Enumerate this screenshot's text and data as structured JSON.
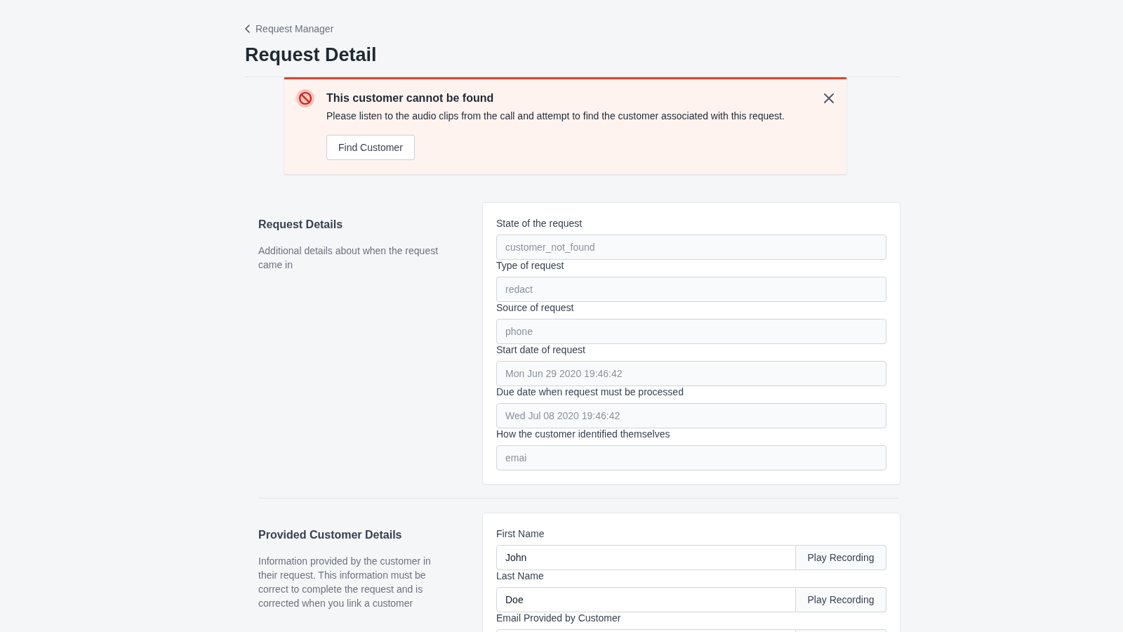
{
  "breadcrumb": {
    "label": "Request Manager"
  },
  "page_title": "Request Detail",
  "alert": {
    "kind": "error",
    "title": "This customer cannot be found",
    "message": "Please listen to the audio clips from the call and attempt to find the customer associated with this request.",
    "action": "Find Customer",
    "dismissible": true
  },
  "sections": [
    {
      "title": "Request Details",
      "description": "Additional details about when the request came in",
      "fields": [
        {
          "kind": "text",
          "label": "State of the request",
          "value": "customer_not_found",
          "disabled": true
        },
        {
          "kind": "text",
          "label": "Type of request",
          "value": "redact",
          "disabled": true
        },
        {
          "kind": "text",
          "label": "Source of request",
          "value": "phone",
          "disabled": true
        },
        {
          "kind": "text",
          "label": "Start date of request",
          "value": "Mon Jun 29 2020 19:46:42",
          "disabled": true
        },
        {
          "kind": "text",
          "label": "Due date when request must be processed",
          "value": "Wed Jul 08 2020 19:46:42",
          "disabled": true
        },
        {
          "kind": "text",
          "label": "How the customer identified themselves",
          "value": "emai",
          "disabled": true
        }
      ]
    },
    {
      "title": "Provided Customer Details",
      "description": "Information provided by the customer in their request. This information must be correct to complete the request and is corrected when you link a customer",
      "fields": [
        {
          "kind": "recording",
          "label": "First Name",
          "value": "John",
          "disabled": false,
          "action": "Play Recording"
        },
        {
          "kind": "recording",
          "label": "Last Name",
          "value": "Doe",
          "disabled": false,
          "action": "Play Recording"
        },
        {
          "kind": "recording",
          "label": "Email Provided by Customer"
        }
      ]
    }
  ]
}
